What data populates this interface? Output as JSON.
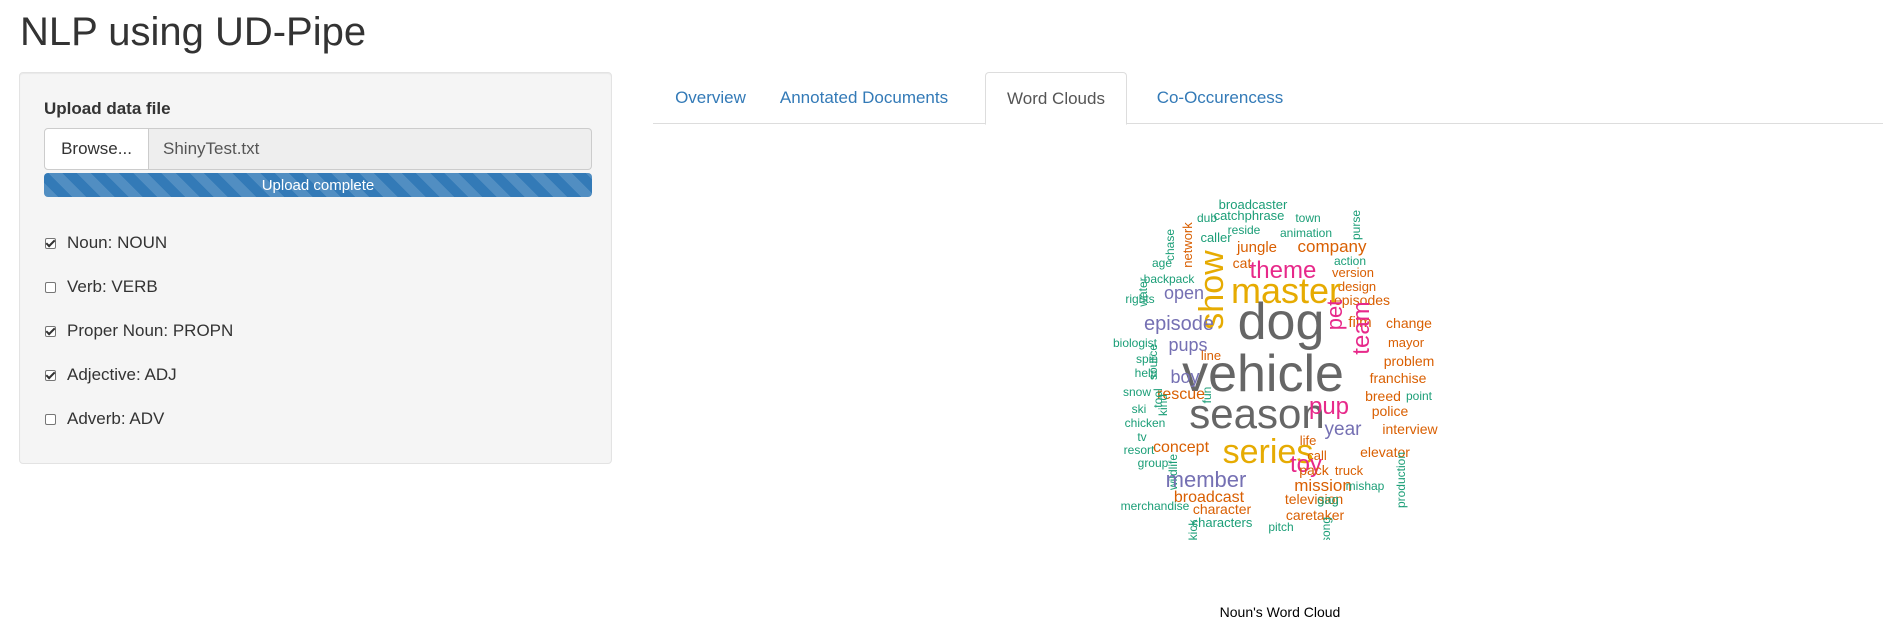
{
  "app": {
    "title": "NLP using UD-Pipe"
  },
  "sidebar": {
    "upload_label": "Upload data file",
    "browse_label": "Browse...",
    "file_name": "ShinyTest.txt",
    "progress_text": "Upload complete",
    "progress_value": 1.0,
    "checkboxes": [
      {
        "label": "Noun: NOUN",
        "checked": true
      },
      {
        "label": "Verb: VERB",
        "checked": false
      },
      {
        "label": "Proper Noun: PROPN",
        "checked": true
      },
      {
        "label": "Adjective: ADJ",
        "checked": true
      },
      {
        "label": "Adverb: ADV",
        "checked": false
      }
    ]
  },
  "tabs": [
    {
      "label": "Overview",
      "active": false
    },
    {
      "label": "Annotated Documents",
      "active": false
    },
    {
      "label": "Word Clouds",
      "active": true
    },
    {
      "label": "Co-Occurencess",
      "active": false
    }
  ],
  "wordcloud": {
    "caption": "Noun's Word Cloud",
    "colors": {
      "teal": "#1b9e77",
      "orange": "#d95f02",
      "purple": "#7570b3",
      "pink": "#e7298a",
      "gold": "#e6ab02",
      "gray": "#666666"
    },
    "words": [
      "broadcaster",
      "dub",
      "catchphrase",
      "town",
      "reside",
      "animation",
      "caller",
      "network",
      "chase",
      "purse",
      "jungle",
      "company",
      "action",
      "age",
      "cat",
      "version",
      "backpack",
      "design",
      "show",
      "theme",
      "master",
      "rights",
      "water",
      "open",
      "episodes",
      "dog",
      "pet",
      "episode",
      "film",
      "change",
      "biologist",
      "pups",
      "line",
      "mayor",
      "spin",
      "team",
      "vehicle",
      "boy",
      "problem",
      "help",
      "source",
      "rescue",
      "fun",
      "franchise",
      "snow",
      "tool",
      "season",
      "pup",
      "breed",
      "point",
      "kind",
      "police",
      "ski",
      "year",
      "interview",
      "chicken",
      "life",
      "tv",
      "concept",
      "series",
      "call",
      "elevator",
      "resort",
      "toy",
      "pack",
      "truck",
      "wildlife",
      "member",
      "production",
      "group",
      "mission",
      "mishap",
      "broadcast",
      "television",
      "gag",
      "merchandise",
      "character",
      "caretaker",
      "kick",
      "characters",
      "song",
      "pitch"
    ]
  }
}
